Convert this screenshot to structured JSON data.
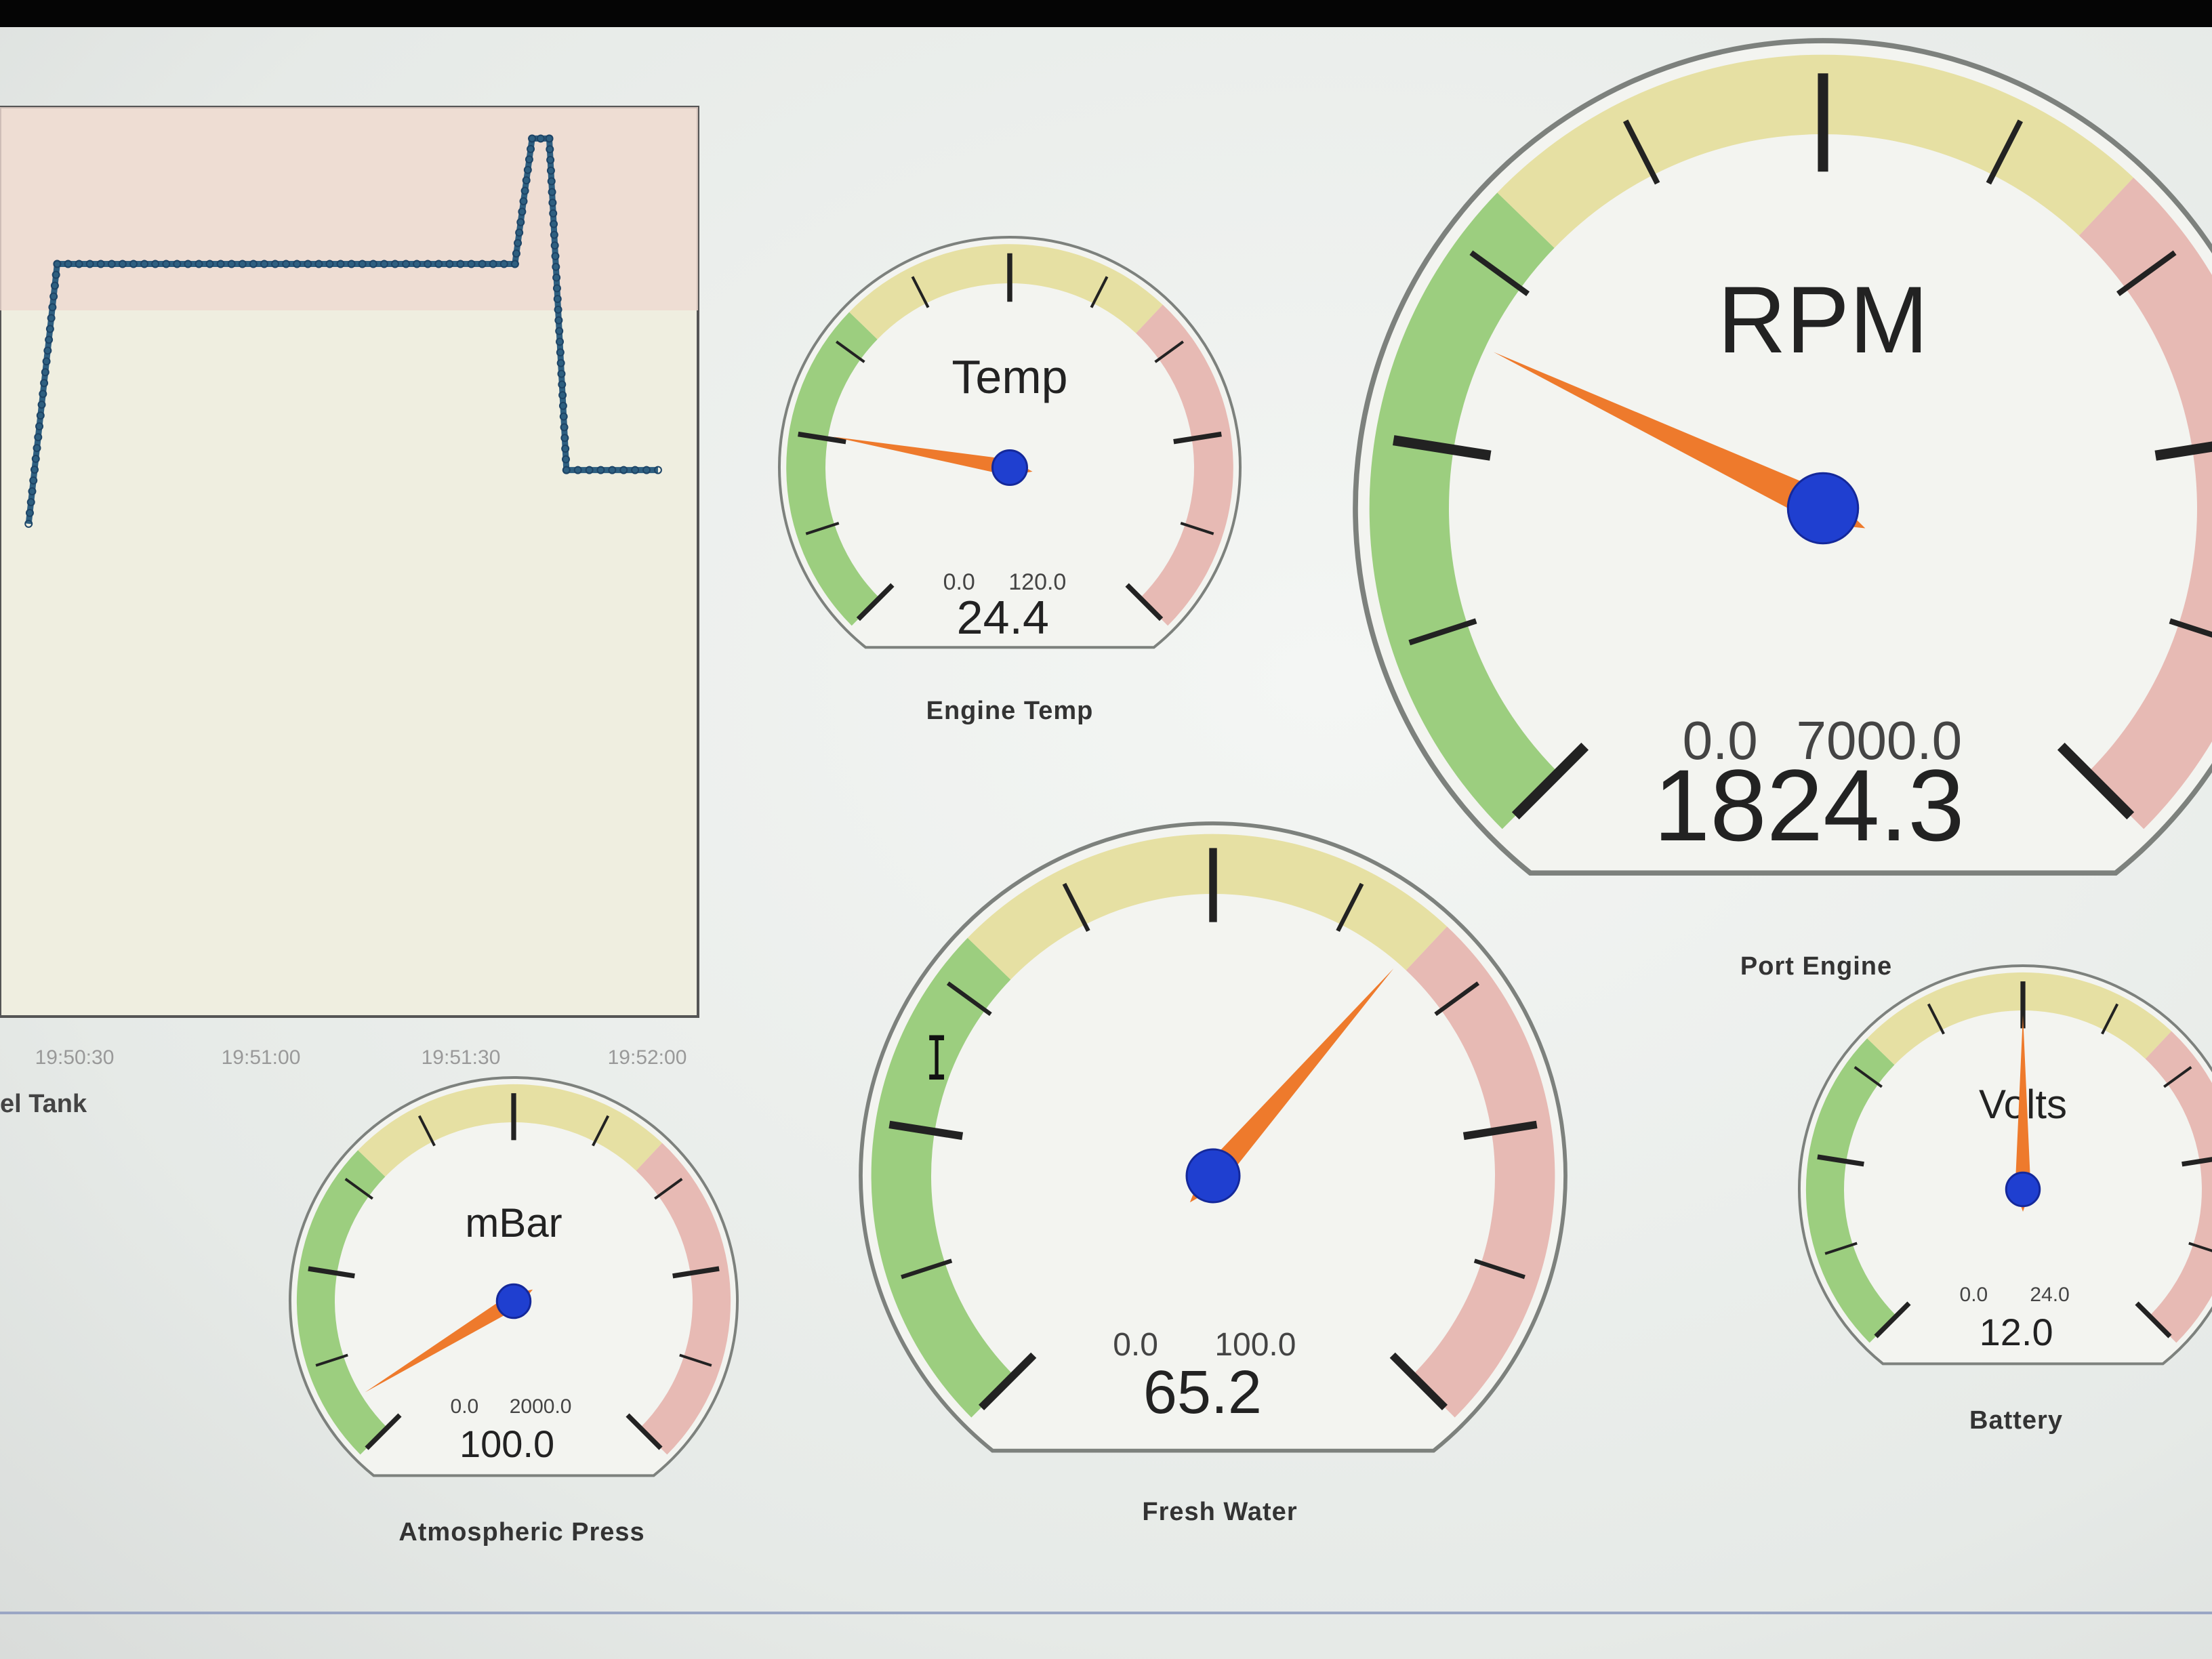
{
  "chart_panel": {
    "name": "el Tank",
    "x_ticks": [
      "19:50:30",
      "19:51:00",
      "19:51:30",
      "19:52:00"
    ],
    "colors": {
      "plot_bg": "#efeee0",
      "band": "#eed8cf",
      "line": "#2e5f80"
    }
  },
  "chart_data": {
    "type": "line",
    "title": "",
    "xlabel": "",
    "ylabel": "",
    "x": [
      "19:50:15",
      "19:50:20",
      "19:51:40",
      "19:51:43",
      "19:51:46",
      "19:51:49",
      "19:52:05"
    ],
    "series": [
      {
        "values": [
          55,
          84,
          84,
          98,
          98,
          61,
          61
        ]
      }
    ],
    "ylim": [
      0,
      100
    ],
    "grid": false
  },
  "gauges": [
    {
      "id": "port-engine",
      "title": "RPM",
      "caption": "Port Engine",
      "min_label": "0.0",
      "max_label": "7000.0",
      "value_label": "1824.3",
      "min": 0,
      "max": 7000,
      "value": 1824.3
    },
    {
      "id": "engine-temp",
      "title": "Temp",
      "caption": "Engine Temp",
      "min_label": "0.0",
      "max_label": "120.0",
      "value_label": "24.4",
      "min": 0,
      "max": 120,
      "value": 24.4
    },
    {
      "id": "fresh-water",
      "title": "",
      "caption": "Fresh Water",
      "min_label": "0.0",
      "max_label": "100.0",
      "value_label": "65.2",
      "min": 0,
      "max": 100,
      "value": 65.2
    },
    {
      "id": "atmospheric-press",
      "title": "mBar",
      "caption": "Atmospheric Press",
      "min_label": "0.0",
      "max_label": "2000.0",
      "value_label": "100.0",
      "min": 0,
      "max": 2000,
      "value": 100
    },
    {
      "id": "battery",
      "title": "Volts",
      "caption": "Battery",
      "min_label": "0.0",
      "max_label": "24.0",
      "value_label": "12.0",
      "min": 0,
      "max": 24,
      "value": 12
    }
  ],
  "colors": {
    "green_zone": "#7fc25a",
    "yellow_zone": "#e2d98a",
    "red_zone": "#e3a7a0",
    "needle": "#ee7a2c",
    "hub": "#1f3fd0"
  }
}
